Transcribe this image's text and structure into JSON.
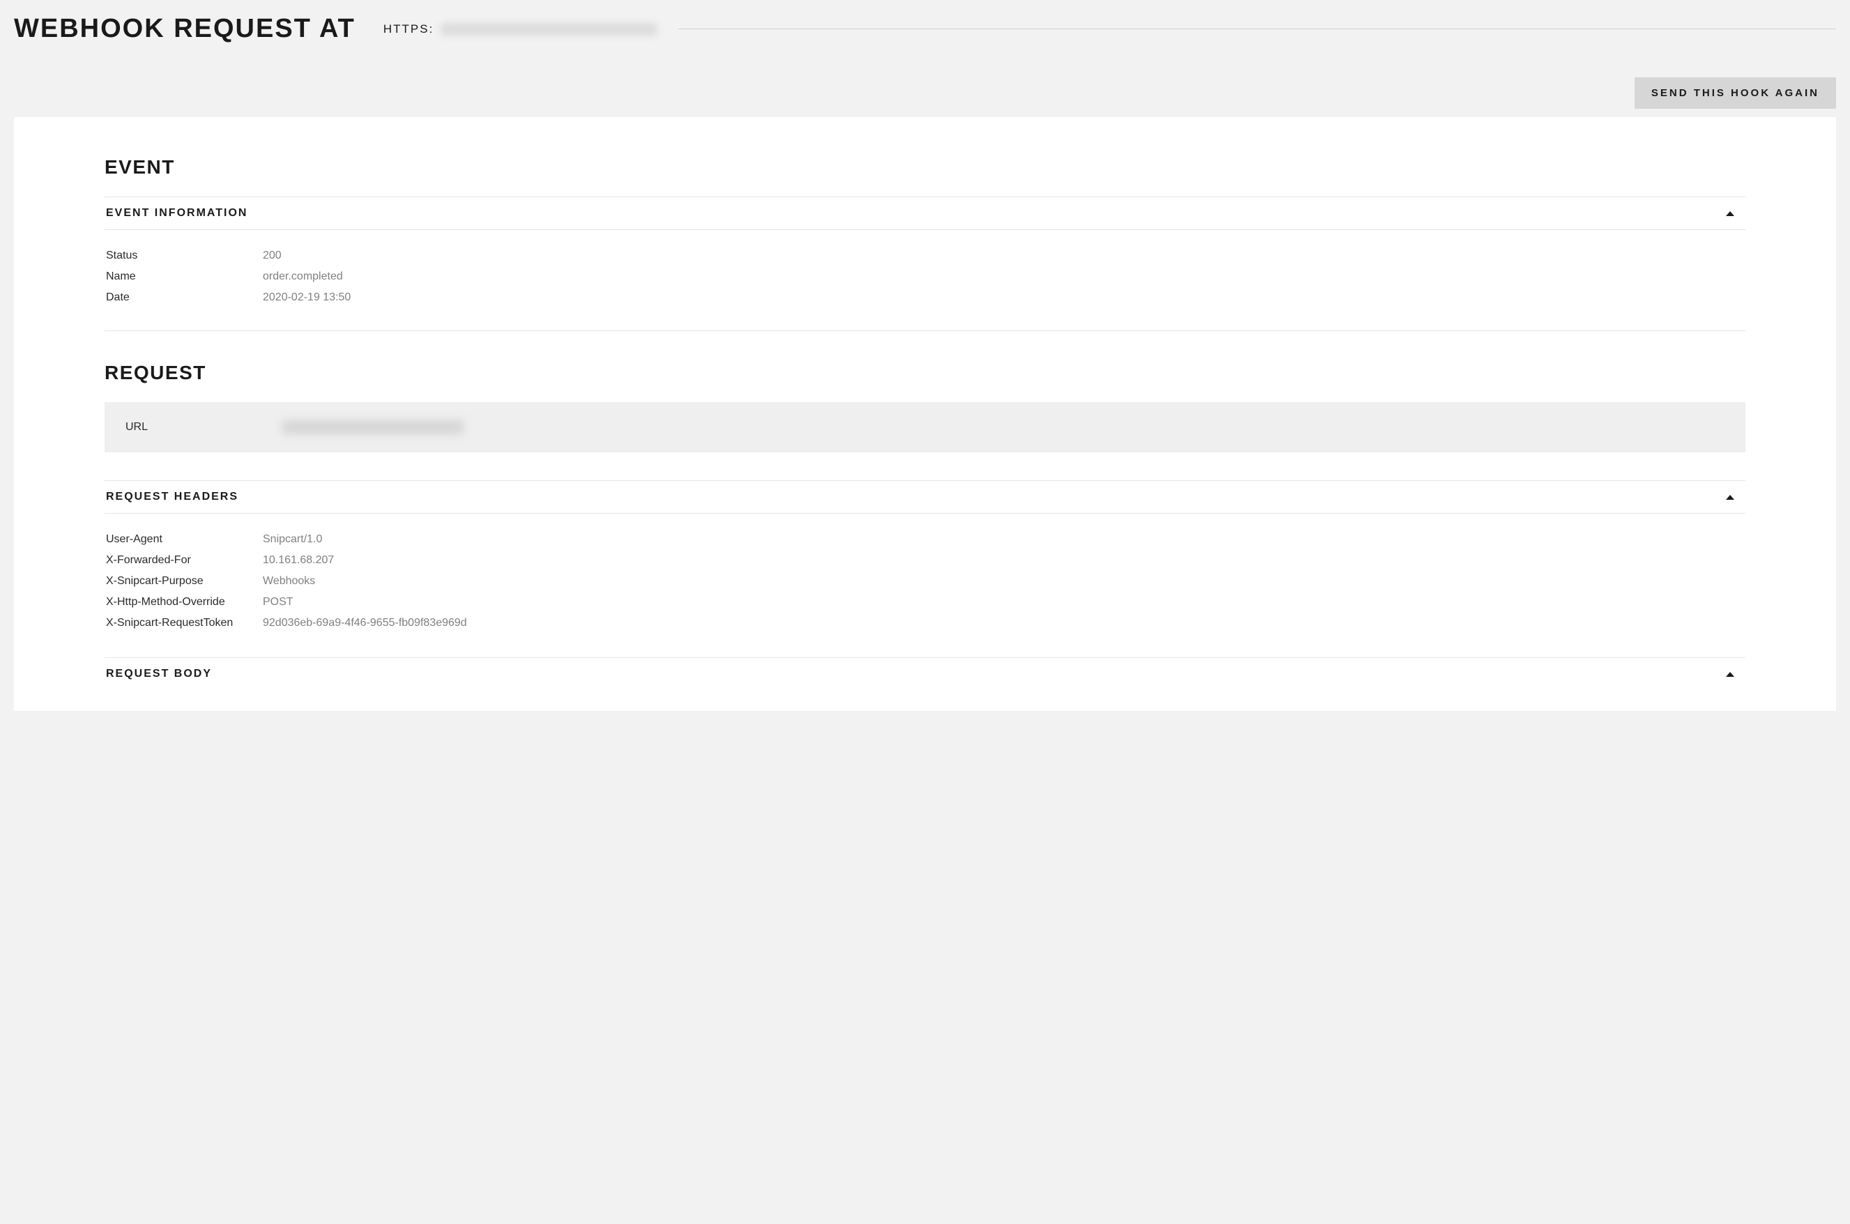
{
  "header": {
    "title": "WEBHOOK REQUEST AT",
    "url_prefix": "HTTPS:",
    "resend_button": "SEND THIS HOOK AGAIN"
  },
  "event": {
    "section_title": "EVENT",
    "sub_title": "EVENT INFORMATION",
    "rows": [
      {
        "key": "Status",
        "value": "200"
      },
      {
        "key": "Name",
        "value": "order.completed"
      },
      {
        "key": "Date",
        "value": "2020-02-19 13:50"
      }
    ]
  },
  "request": {
    "section_title": "REQUEST",
    "url_label": "URL",
    "headers_title": "REQUEST HEADERS",
    "headers": [
      {
        "key": "User-Agent",
        "value": "Snipcart/1.0"
      },
      {
        "key": "X-Forwarded-For",
        "value": "10.161.68.207"
      },
      {
        "key": "X-Snipcart-Purpose",
        "value": "Webhooks"
      },
      {
        "key": "X-Http-Method-Override",
        "value": "POST"
      },
      {
        "key": "X-Snipcart-RequestToken",
        "value": "92d036eb-69a9-4f46-9655-fb09f83e969d"
      }
    ],
    "body_title": "REQUEST BODY"
  }
}
